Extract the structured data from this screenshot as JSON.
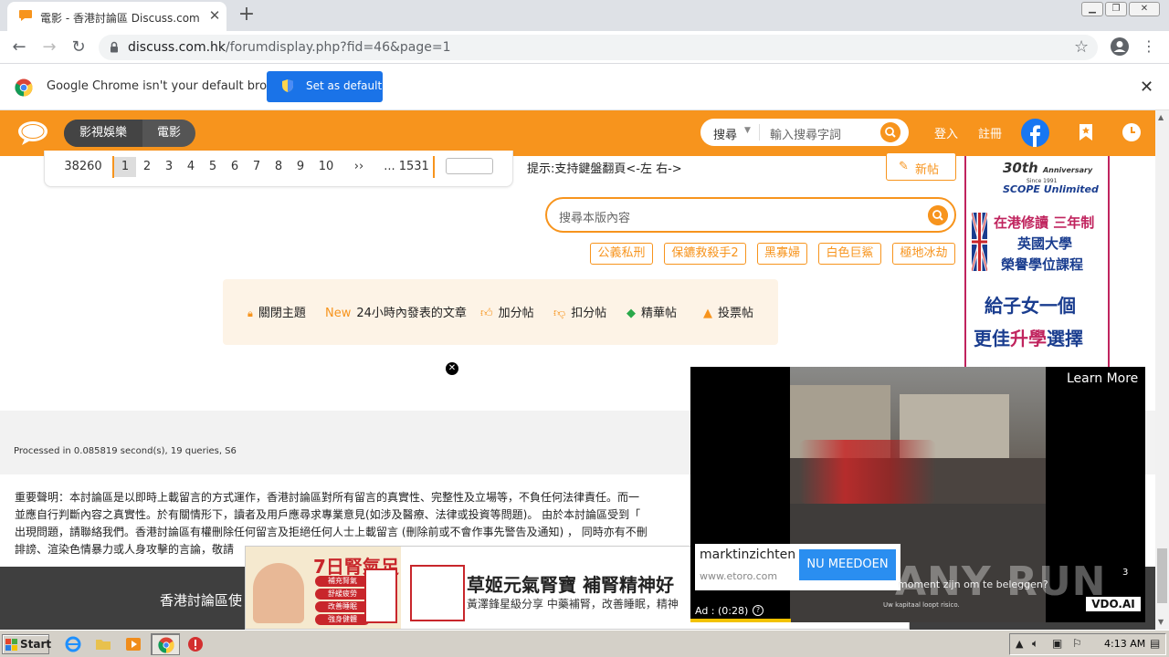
{
  "browser": {
    "tab_title": "電影 - 香港討論區 Discuss.com.hk -",
    "url_host": "discuss.com.hk",
    "url_path": "/forumdisplay.php?fid=46&page=1",
    "infobar_text": "Google Chrome isn't your default browser",
    "set_default_label": "Set as default"
  },
  "header": {
    "crumbs": [
      "影視娛樂",
      "電影"
    ],
    "search_type": "搜尋",
    "search_placeholder": "輸入搜尋字詞",
    "login": "登入",
    "register": "註冊"
  },
  "pager": {
    "total": "38260",
    "pages": [
      "1",
      "2",
      "3",
      "4",
      "5",
      "6",
      "7",
      "8",
      "9",
      "10"
    ],
    "next": "››",
    "last": "... 1531",
    "current": "1"
  },
  "hint": "提示:支持鍵盤翻頁<-左 右->",
  "new_post_label": "新帖",
  "board_search_placeholder": "搜尋本版內容",
  "tags": [
    "公義私刑",
    "保鑣救殺手2",
    "黑寡婦",
    "白色巨鯊",
    "極地冰劫"
  ],
  "filters": [
    {
      "icon": "lock-icon",
      "label": "關閉主題"
    },
    {
      "icon": "new-badge",
      "badge": "New",
      "label": "24小時內發表的文章"
    },
    {
      "icon": "thumbs-up-icon",
      "label": "加分帖"
    },
    {
      "icon": "thumbs-down-icon",
      "label": "扣分帖"
    },
    {
      "icon": "gem-icon",
      "label": "精華帖"
    },
    {
      "icon": "vote-icon",
      "label": "投票帖"
    }
  ],
  "right_ad": {
    "anniversary": "30th",
    "anniversary_sub": "Anniversary",
    "since": "Since 1991",
    "brand": "SCOPE Unlimited",
    "line1": "在港修讀 三年制",
    "line2": "英國大學",
    "line3": "榮譽學位課程",
    "line4": "給子女一個",
    "line5_pre": "更佳",
    "line5_hl": "升學",
    "line5_post": "選擇"
  },
  "footer": {
    "processed": "Processed in 0.085819 second(s), 19 queries, S6",
    "disclaimer_lines": [
      "重要聲明：本討論區是以即時上載留言的方式運作，香港討論區對所有留言的真實性、完整性及立場等，不負任何法律責任。而一",
      "並應自行判斷內容之真實性。於有關情形下，讀者及用戶應尋求專業意見(如涉及醫療、法律或投資等問題)。 由於本討論區受到「",
      "出現問題，請聯絡我們。香港討論區有權刪除任何留言及拒絕任何人士上載留言 (刪除前或不會作事先警告及通知) ， 同時亦有不刪",
      "誹謗、渲染色情暴力或人身攻擊的言論，敬請"
    ],
    "dark_text": "香港討論區使"
  },
  "bottom_ad": {
    "headline_left": "7日腎氣足",
    "bullets": [
      "補充腎氣",
      "舒緩疲勞",
      "改善睡眠",
      "強身健體"
    ],
    "title": "草姬元氣腎寶 補腎精神好",
    "subtitle": "黃澤鋒星級分享 中藥補腎，改善睡眠，精神"
  },
  "video_ad": {
    "learn_more": "Learn More",
    "advertiser": "marktinzichten",
    "advertiser_url": "www.etoro.com",
    "cta": "NU MEEDOEN",
    "timer": "Ad : (0:28)",
    "caption": "moment zijn om te beleggen?",
    "risk_caption": "Uw kapitaal loopt risico.",
    "badge": "VDO.AI",
    "watermark_num": "3"
  },
  "watermark": "ANY RUN",
  "taskbar": {
    "start": "Start",
    "clock": "4:13 AM"
  },
  "colors": {
    "brand_orange": "#f7941d",
    "chrome_blue": "#1a73e8",
    "ad_blue": "#1a3d8f",
    "ad_magenta": "#c0245e"
  }
}
